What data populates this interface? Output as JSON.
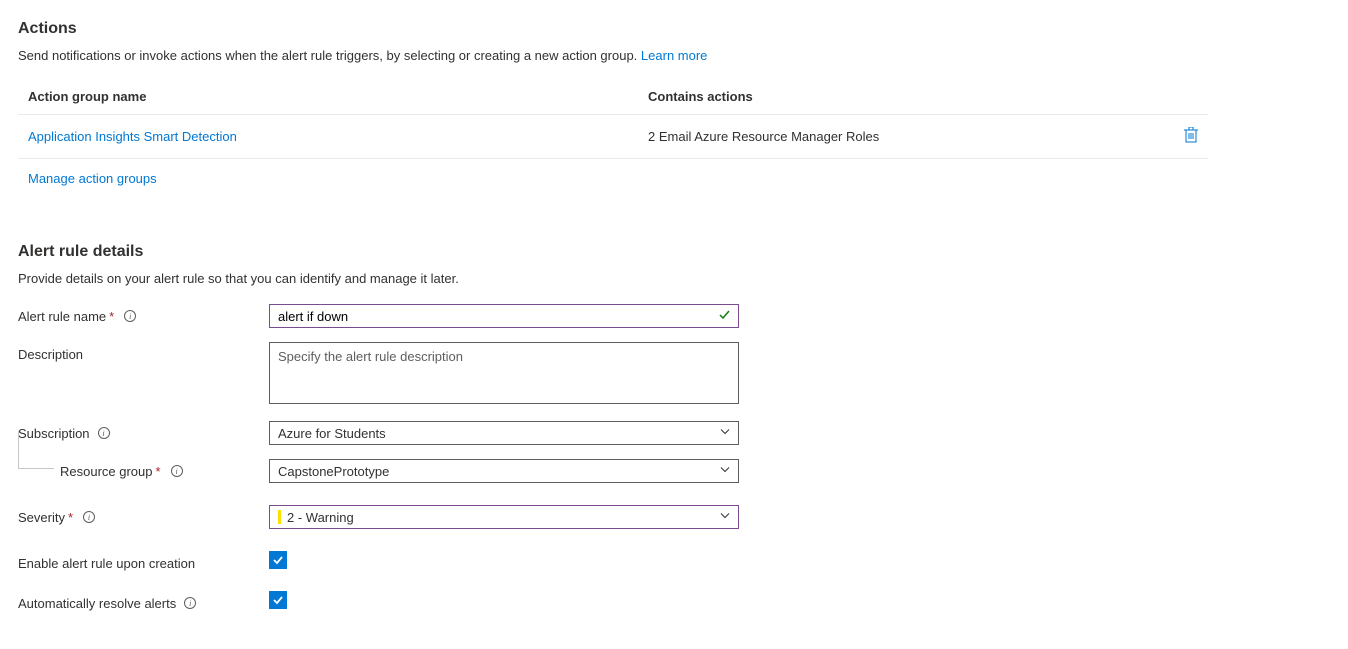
{
  "actions": {
    "heading": "Actions",
    "description": "Send notifications or invoke actions when the alert rule triggers, by selecting or creating a new action group.",
    "learn_more": "Learn more",
    "table": {
      "header_name": "Action group name",
      "header_contains": "Contains actions",
      "rows": [
        {
          "name": "Application Insights Smart Detection",
          "contains": "2 Email Azure Resource Manager Roles"
        }
      ]
    },
    "manage_link": "Manage action groups"
  },
  "details": {
    "heading": "Alert rule details",
    "description": "Provide details on your alert rule so that you can identify and manage it later.",
    "name_label": "Alert rule name",
    "name_value": "alert if down",
    "desc_label": "Description",
    "desc_placeholder": "Specify the alert rule description",
    "desc_value": "",
    "subscription_label": "Subscription",
    "subscription_value": "Azure for Students",
    "resource_group_label": "Resource group",
    "resource_group_value": "CapstonePrototype",
    "severity_label": "Severity",
    "severity_value": "2 - Warning",
    "enable_label": "Enable alert rule upon creation",
    "auto_resolve_label": "Automatically resolve alerts"
  }
}
